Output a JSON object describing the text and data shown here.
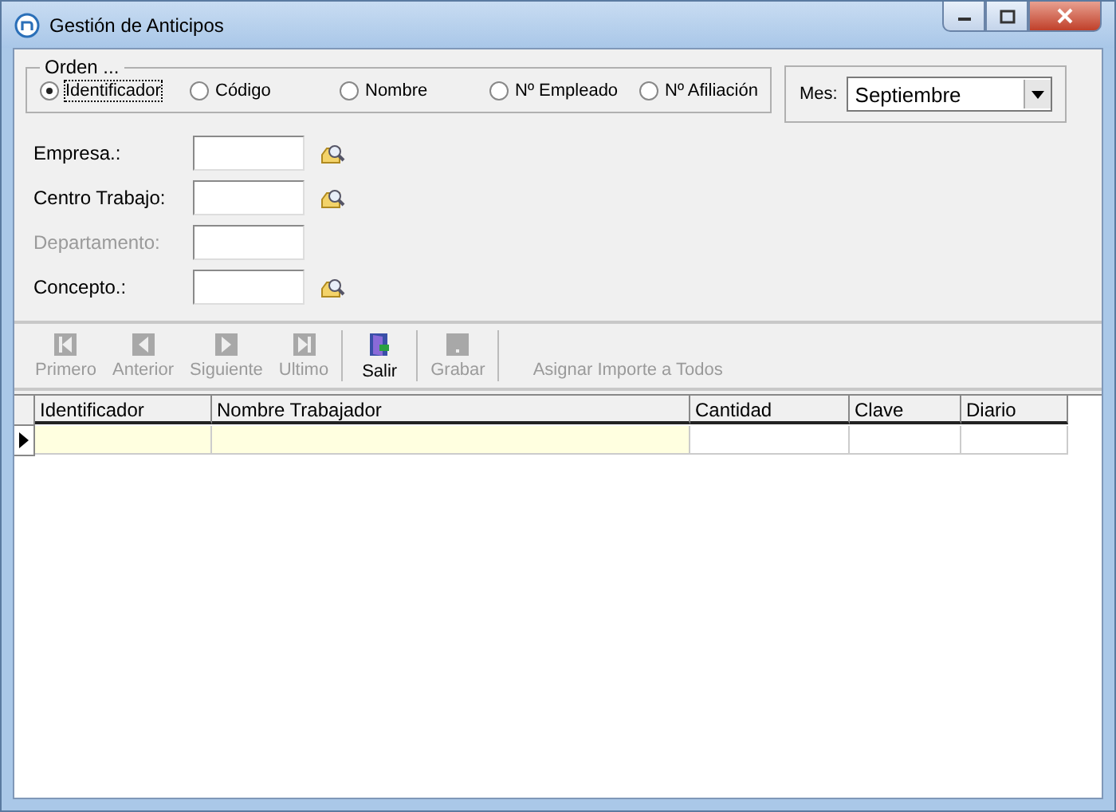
{
  "window": {
    "title": "Gestión de Anticipos"
  },
  "order": {
    "legend": "Orden ...",
    "options": [
      {
        "label": "Identificador",
        "selected": true
      },
      {
        "label": "Código",
        "selected": false
      },
      {
        "label": "Nombre",
        "selected": false
      },
      {
        "label": "Nº Empleado",
        "selected": false
      },
      {
        "label": "Nº Afiliación",
        "selected": false
      }
    ]
  },
  "month": {
    "label": "Mes:",
    "value": "Septiembre"
  },
  "fields": [
    {
      "label": "Empresa.:",
      "disabled": false,
      "lookup": true
    },
    {
      "label": "Centro Trabajo:",
      "disabled": false,
      "lookup": true
    },
    {
      "label": "Departamento:",
      "disabled": true,
      "lookup": false
    },
    {
      "label": "Concepto.:",
      "disabled": false,
      "lookup": true
    }
  ],
  "toolbar": [
    {
      "label": "Primero",
      "kind": "first",
      "disabled": true
    },
    {
      "label": "Anterior",
      "kind": "prev",
      "disabled": true
    },
    {
      "label": "Siguiente",
      "kind": "next",
      "disabled": true
    },
    {
      "label": "Ultimo",
      "kind": "last",
      "disabled": true
    },
    {
      "kind": "separator"
    },
    {
      "label": "Salir",
      "kind": "exit",
      "disabled": false
    },
    {
      "kind": "separator"
    },
    {
      "label": "Grabar",
      "kind": "save",
      "disabled": true
    },
    {
      "kind": "separator"
    },
    {
      "label": "Asignar Importe a Todos",
      "kind": "text",
      "disabled": true
    }
  ],
  "table": {
    "columns": [
      {
        "label": "Identificador",
        "highlighted": true
      },
      {
        "label": "Nombre  Trabajador",
        "highlighted": true
      },
      {
        "label": "Cantidad",
        "highlighted": false
      },
      {
        "label": "Clave",
        "highlighted": false
      },
      {
        "label": "Diario",
        "highlighted": false
      }
    ],
    "rows": [
      {
        "selected": true
      }
    ]
  }
}
